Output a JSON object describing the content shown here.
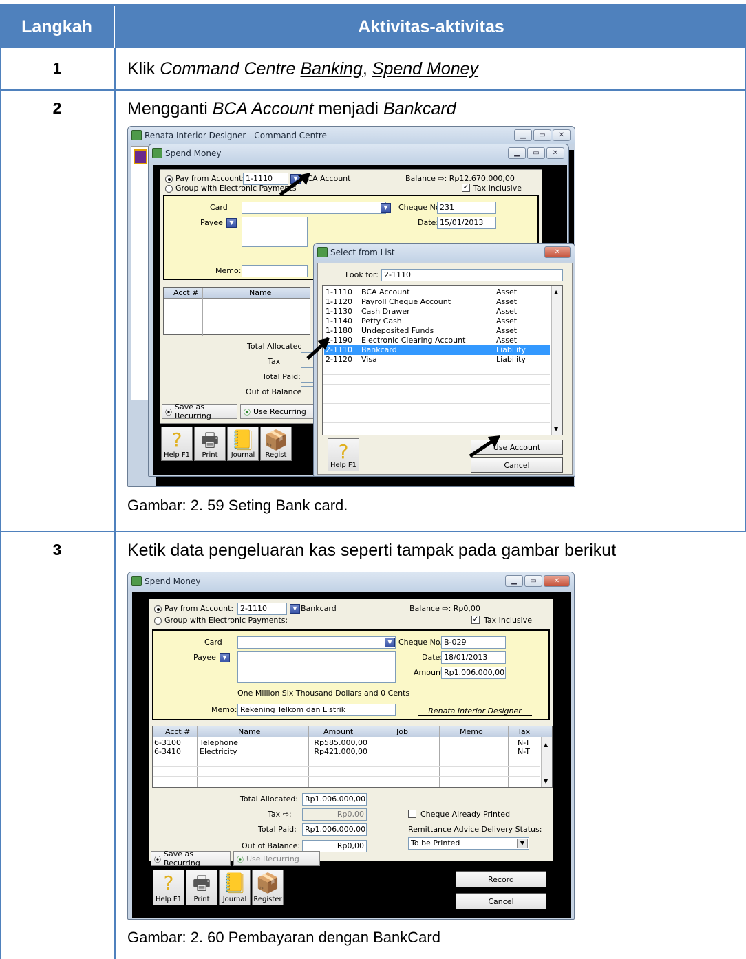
{
  "table": {
    "col_step": "Langkah",
    "col_activity": "Aktivitas-aktivitas"
  },
  "step1": {
    "number": "1",
    "text_plain": "Klik ",
    "text_italic": "Command Centre",
    "text_link1": "Banking",
    "text_sep": ", ",
    "text_link2": "Spend Money"
  },
  "step2": {
    "number": "2",
    "text_a": "Mengganti ",
    "text_b": "BCA Account",
    "text_c": " menjadi ",
    "text_d": "Bankcard",
    "caption": "Gambar: 2. 59 Seting Bank card."
  },
  "step3": {
    "number": "3",
    "text": "Ketik data pengeluaran kas seperti tampak pada gambar berikut",
    "caption": "Gambar: 2. 60 Pembayaran dengan BankCard"
  },
  "shot1": {
    "cc_title": "Renata Interior Designer - Command Centre",
    "sm_title": "Spend Money",
    "pay_from_label": "Pay from Account:",
    "pay_from_value": "1-1110",
    "account_name": "BCA Account",
    "balance": "Balance ⇨: Rp12.670.000,00",
    "group_label": "Group with Electronic Payments",
    "tax_inclusive": "Tax Inclusive",
    "card_label": "Card",
    "cheque_label": "Cheque No.:",
    "cheque_value": "231",
    "payee_label": "Payee",
    "date_label": "Date:",
    "date_value": "15/01/2013",
    "memo_label": "Memo:",
    "grid_acct": "Acct #",
    "grid_name": "Name",
    "total_allocated": "Total Allocated:",
    "tax": "Tax",
    "total_paid": "Total Paid:",
    "out_of_balance": "Out of Balance:",
    "save_recurring": "Save as Recurring",
    "use_recurring": "Use Recurring",
    "help": "Help F1",
    "print": "Print",
    "journal": "Journal",
    "register": "Regist",
    "dialog_title": "Select from List",
    "look_for_label": "Look for:",
    "look_for_value": "2-1110",
    "accounts": [
      {
        "code": "1-1110",
        "name": "BCA Account",
        "type": "Asset"
      },
      {
        "code": "1-1120",
        "name": "Payroll Cheque Account",
        "type": "Asset"
      },
      {
        "code": "1-1130",
        "name": "Cash Drawer",
        "type": "Asset"
      },
      {
        "code": "1-1140",
        "name": "Petty Cash",
        "type": "Asset"
      },
      {
        "code": "1-1180",
        "name": "Undeposited Funds",
        "type": "Asset"
      },
      {
        "code": "1-1190",
        "name": "Electronic Clearing Account",
        "type": "Asset"
      },
      {
        "code": "2-1110",
        "name": "Bankcard",
        "type": "Liability"
      },
      {
        "code": "2-1120",
        "name": "Visa",
        "type": "Liability"
      }
    ],
    "use_account": "Use Account",
    "cancel": "Cancel",
    "dialog_help": "Help F1"
  },
  "shot2": {
    "title": "Spend Money",
    "pay_from_label": "Pay from Account:",
    "pay_from_value": "2-1110",
    "account_name": "Bankcard",
    "balance": "Balance ⇨: Rp0,00",
    "group_label": "Group with Electronic Payments:",
    "tax_inclusive": "Tax Inclusive",
    "card_label": "Card",
    "cheque_label": "Cheque No.:",
    "cheque_value": "B-029",
    "payee_label": "Payee",
    "date_label": "Date:",
    "date_value": "18/01/2013",
    "amount_label": "Amount:",
    "amount_value": "Rp1.006.000,00",
    "words": "One Million Six Thousand Dollars and 0 Cents",
    "memo_label": "Memo:",
    "memo_value": "Rekening Telkom dan Listrik",
    "signature": "Renata Interior Designer",
    "columns": [
      "Acct #",
      "Name",
      "Amount",
      "Job",
      "Memo",
      "Tax"
    ],
    "rows": [
      {
        "acct": "6-3100",
        "name": "Telephone",
        "amount": "Rp585.000,00",
        "tax": "N-T"
      },
      {
        "acct": "6-3410",
        "name": "Electricity",
        "amount": "Rp421.000,00",
        "tax": "N-T"
      }
    ],
    "total_allocated_label": "Total Allocated:",
    "total_allocated": "Rp1.006.000,00",
    "tax_label": "Tax ⇨:",
    "tax_value": "Rp0,00",
    "total_paid_label": "Total Paid:",
    "total_paid": "Rp1.006.000,00",
    "out_of_balance_label": "Out of Balance:",
    "out_of_balance": "Rp0,00",
    "cheque_printed": "Cheque Already Printed",
    "remittance_label": "Remittance Advice Delivery Status:",
    "remittance_value": "To be Printed",
    "save_recurring": "Save as Recurring",
    "use_recurring": "Use Recurring",
    "help": "Help F1",
    "print": "Print",
    "journal": "Journal",
    "register": "Register",
    "record": "Record",
    "cancel": "Cancel"
  }
}
